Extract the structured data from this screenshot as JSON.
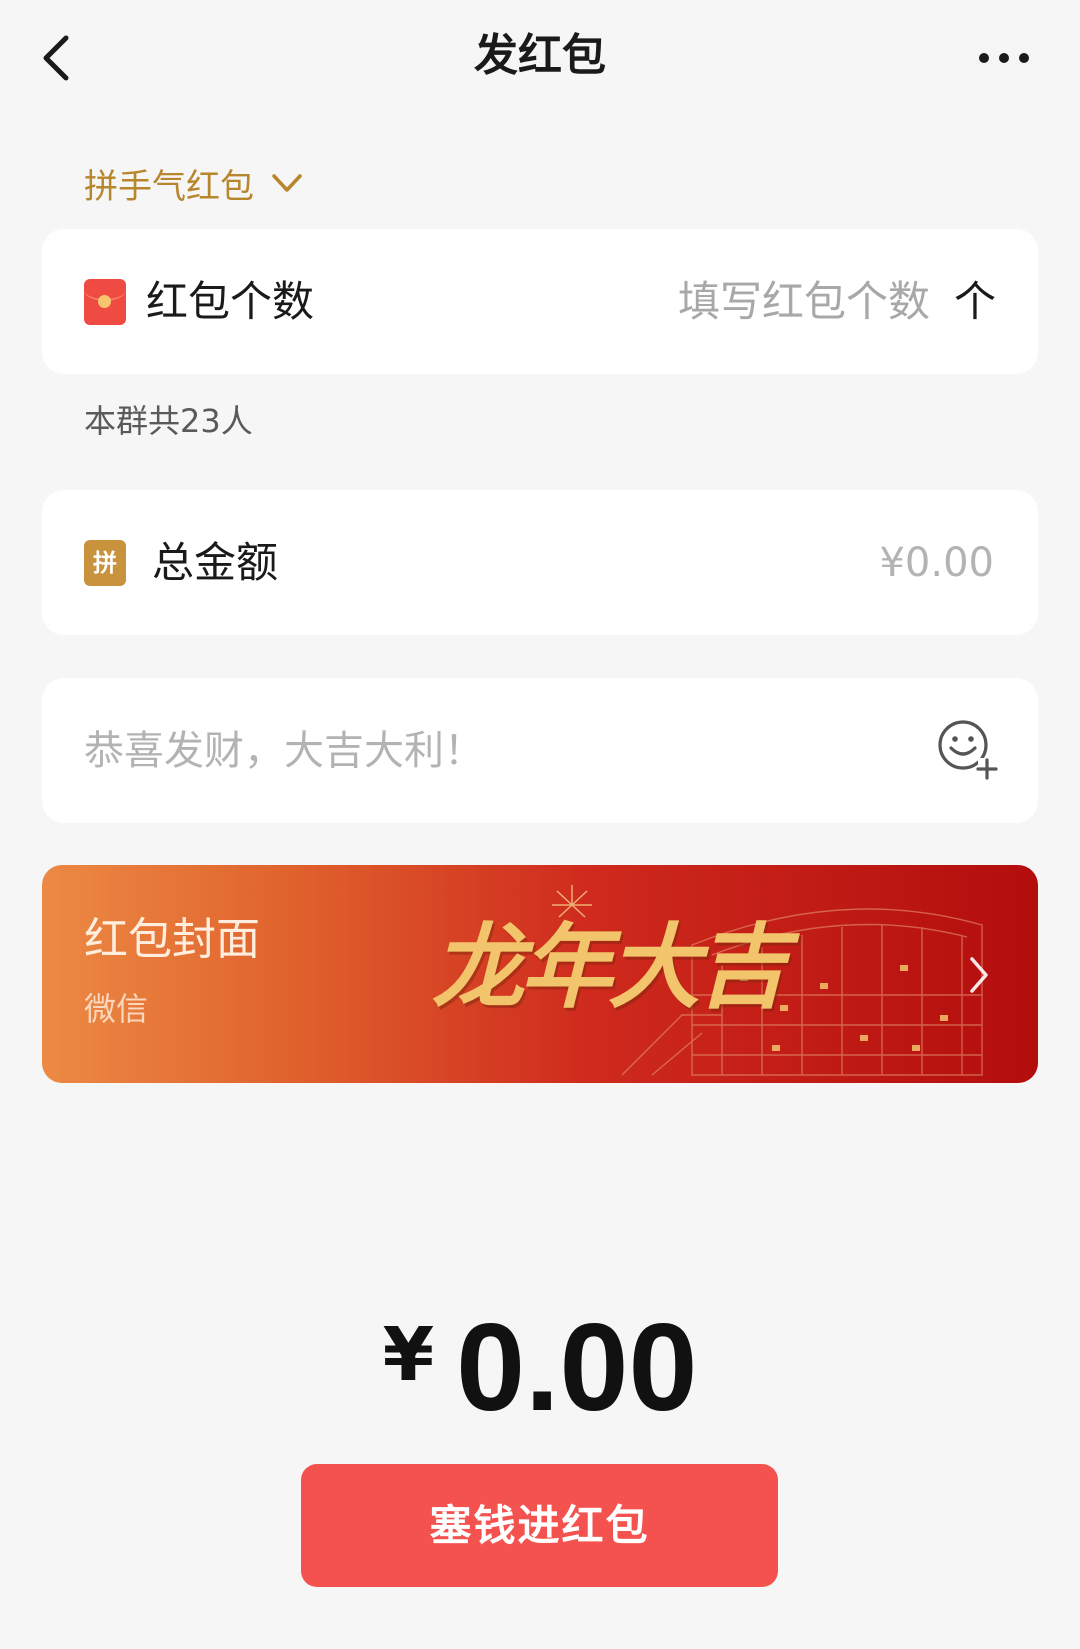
{
  "header": {
    "title": "发红包",
    "back_icon": "chevron-left-icon",
    "more_icon": "more-horizontal-icon"
  },
  "packet_type": {
    "label": "拼手气红包",
    "icon": "chevron-down-icon"
  },
  "count_row": {
    "icon": "red-packet-icon",
    "label": "红包个数",
    "placeholder": "填写红包个数",
    "unit": "个"
  },
  "group_note": "本群共23人",
  "total_row": {
    "icon": "pin-badge-icon",
    "icon_text": "拼",
    "label": "总金额",
    "amount": "¥0.00"
  },
  "greeting": {
    "placeholder": "恭喜发财，大吉大利！",
    "emoji_icon": "emoji-add-icon"
  },
  "cover": {
    "title": "红包封面",
    "subtitle": "微信",
    "artwork_text": "龙年大吉",
    "icon": "chevron-right-icon"
  },
  "amount_display": {
    "currency": "¥",
    "value": "0.00"
  },
  "submit_button": {
    "label": "塞钱进红包"
  },
  "colors": {
    "background": "#f6f6f6",
    "gold_accent": "#b8862c",
    "red_button": "#f4524f",
    "placeholder": "#a8a8a8"
  }
}
